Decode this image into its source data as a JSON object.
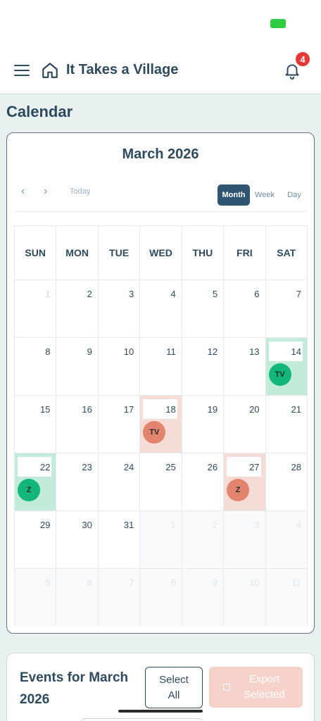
{
  "app": {
    "title": "It Takes a Village",
    "notification_count": "4"
  },
  "page": {
    "title": "Calendar"
  },
  "calendar": {
    "month_label": "March 2026",
    "prev_icon": "‹",
    "next_icon": "›",
    "today_label": "Today",
    "views": [
      "Month",
      "Week",
      "Day"
    ],
    "active_view": "Month",
    "weekdays": [
      "SUN",
      "MON",
      "TUE",
      "WED",
      "THU",
      "FRI",
      "SAT"
    ],
    "weeks": [
      [
        {
          "d": "1",
          "t": "faded"
        },
        {
          "d": "2"
        },
        {
          "d": "3"
        },
        {
          "d": "4"
        },
        {
          "d": "5"
        },
        {
          "d": "6"
        },
        {
          "d": "7"
        }
      ],
      [
        {
          "d": "8"
        },
        {
          "d": "9"
        },
        {
          "d": "10"
        },
        {
          "d": "11"
        },
        {
          "d": "12"
        },
        {
          "d": "13"
        },
        {
          "d": "14",
          "hl": "green",
          "badge": "TV"
        }
      ],
      [
        {
          "d": "15"
        },
        {
          "d": "16"
        },
        {
          "d": "17"
        },
        {
          "d": "18",
          "hl": "red",
          "badge": "TV"
        },
        {
          "d": "19"
        },
        {
          "d": "20"
        },
        {
          "d": "21"
        }
      ],
      [
        {
          "d": "22",
          "hl": "green",
          "badge": "Z"
        },
        {
          "d": "23"
        },
        {
          "d": "24"
        },
        {
          "d": "25"
        },
        {
          "d": "26"
        },
        {
          "d": "27",
          "hl": "red",
          "badge": "Z"
        },
        {
          "d": "28"
        }
      ],
      [
        {
          "d": "29"
        },
        {
          "d": "30"
        },
        {
          "d": "31"
        },
        {
          "d": "1",
          "t": "other"
        },
        {
          "d": "2",
          "t": "other"
        },
        {
          "d": "3",
          "t": "other"
        },
        {
          "d": "4",
          "t": "other"
        }
      ],
      [
        {
          "d": "5",
          "t": "other"
        },
        {
          "d": "6",
          "t": "other"
        },
        {
          "d": "7",
          "t": "other"
        },
        {
          "d": "8",
          "t": "other"
        },
        {
          "d": "9",
          "t": "other"
        },
        {
          "d": "10",
          "t": "other"
        },
        {
          "d": "11",
          "t": "other"
        }
      ]
    ]
  },
  "events": {
    "title": "Events for March 2026",
    "select_all_label": "Select All",
    "export_label": "Export Selected"
  },
  "colors": {
    "primary": "#2d4a5e",
    "accent_active": "#2e5673",
    "green_highlight": "#c3ebd9",
    "green_badge": "#12b57a",
    "red_highlight": "#f6dcd6",
    "red_badge": "#e3846f",
    "notification": "#e53935"
  },
  "icons": [
    "menu-icon",
    "home-icon",
    "bell-icon",
    "calendar-icon"
  ]
}
